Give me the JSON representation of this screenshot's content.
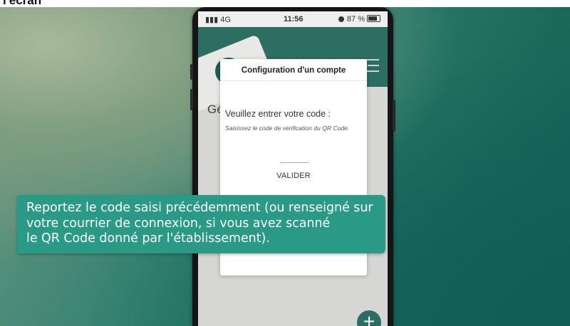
{
  "page": {
    "top_label": "l'écran"
  },
  "status_bar": {
    "signal": "4G",
    "time": "11:56",
    "battery": "87 %"
  },
  "app": {
    "heading_partial": "Gé"
  },
  "modal": {
    "title": "Configuration d'un compte",
    "prompt": "Veuillez entrer votre code :",
    "help": "Saisissez le code de vérification du QR Code.",
    "code_value": "",
    "validate_label": "VALIDER"
  },
  "caption": {
    "lines": [
      "Reportez le code saisi précédemment (ou renseigné sur",
      "votre courrier de connexion, si vous avez scanné",
      "le QR Code donné par l'établissement)."
    ]
  },
  "colors": {
    "brand_green": "#2d6e63",
    "caption_bg": "#2a9985"
  },
  "icons": [
    "signal-icon",
    "alarm-icon",
    "battery-icon",
    "butterfly-logo-icon",
    "hamburger-menu-icon",
    "plus-icon"
  ]
}
